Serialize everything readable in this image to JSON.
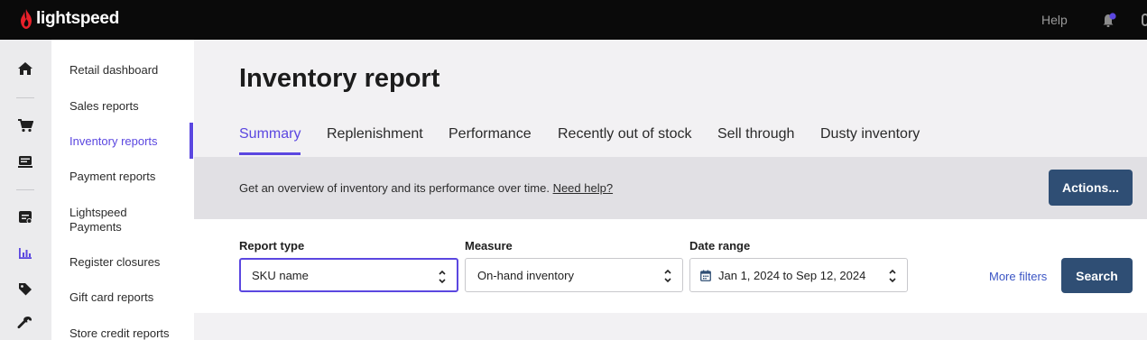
{
  "header": {
    "brand": "lightspeed",
    "help_label": "Help"
  },
  "rail": {
    "icons": [
      "home-icon",
      "cart-icon",
      "register-icon",
      "receipt-icon",
      "reports-icon",
      "tag-icon",
      "wrench-icon"
    ],
    "active_icon": "reports-icon"
  },
  "subnav": {
    "items": [
      {
        "label": "Retail dashboard"
      },
      {
        "label": "Sales reports"
      },
      {
        "label": "Inventory reports"
      },
      {
        "label": "Payment reports"
      },
      {
        "label": "Lightspeed\nPayments"
      },
      {
        "label": "Register closures"
      },
      {
        "label": "Gift card reports"
      },
      {
        "label": "Store credit reports"
      }
    ],
    "active_index": 2
  },
  "page": {
    "title": "Inventory report",
    "tabs": [
      {
        "label": "Summary"
      },
      {
        "label": "Replenishment"
      },
      {
        "label": "Performance"
      },
      {
        "label": "Recently out of stock"
      },
      {
        "label": "Sell through"
      },
      {
        "label": "Dusty inventory"
      }
    ],
    "active_tab": "Summary"
  },
  "info": {
    "text": "Get an overview of inventory and its performance over time.",
    "link": "Need help?",
    "actions_label": "Actions..."
  },
  "filters": {
    "report_type": {
      "label": "Report type",
      "value": "SKU name"
    },
    "measure": {
      "label": "Measure",
      "value": "On-hand inventory"
    },
    "date_range": {
      "label": "Date range",
      "value": "Jan 1, 2024 to Sep 12, 2024"
    },
    "more_filters_label": "More filters",
    "search_label": "Search"
  },
  "colors": {
    "accent": "#5b47e0",
    "primary_button": "#2f4e74",
    "notification_dot": "#5b47e0",
    "brand_red": "#e8202a"
  }
}
